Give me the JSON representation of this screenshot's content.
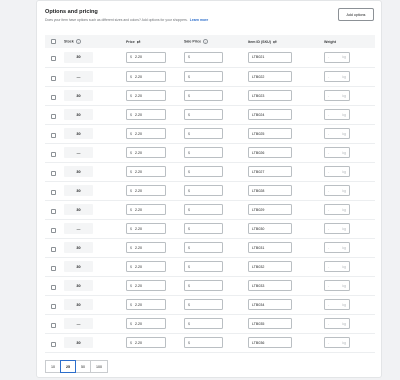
{
  "section": {
    "title": "Options and pricing",
    "description": "Does your item have options such as different sizes and colors? Add options for your shoppers.",
    "learn_more": "Learn more",
    "add_options_label": "Add options"
  },
  "table": {
    "columns": {
      "stock": "Stock",
      "price": "Price",
      "sale_price": "Sale Price",
      "item_id": "Item ID (SKU)",
      "weight": "Weight"
    },
    "currency_symbol": "$",
    "weight_placeholder": "-",
    "weight_unit": "kg",
    "rows": [
      {
        "stock": "30",
        "price": "2.20",
        "sale_price": "",
        "sku": "LTB021"
      },
      {
        "stock": "—",
        "price": "2.20",
        "sale_price": "",
        "sku": "LTB022"
      },
      {
        "stock": "30",
        "price": "2.20",
        "sale_price": "",
        "sku": "LTB023"
      },
      {
        "stock": "30",
        "price": "2.20",
        "sale_price": "",
        "sku": "LTB024"
      },
      {
        "stock": "30",
        "price": "2.20",
        "sale_price": "",
        "sku": "LTB025"
      },
      {
        "stock": "—",
        "price": "2.20",
        "sale_price": "",
        "sku": "LTB026"
      },
      {
        "stock": "30",
        "price": "2.20",
        "sale_price": "",
        "sku": "LTB027"
      },
      {
        "stock": "30",
        "price": "2.20",
        "sale_price": "",
        "sku": "LTB028"
      },
      {
        "stock": "30",
        "price": "2.20",
        "sale_price": "",
        "sku": "LTB029"
      },
      {
        "stock": "—",
        "price": "2.20",
        "sale_price": "",
        "sku": "LTB030"
      },
      {
        "stock": "30",
        "price": "2.20",
        "sale_price": "",
        "sku": "LTB031"
      },
      {
        "stock": "30",
        "price": "2.20",
        "sale_price": "",
        "sku": "LTB032"
      },
      {
        "stock": "30",
        "price": "2.20",
        "sale_price": "",
        "sku": "LTB033"
      },
      {
        "stock": "30",
        "price": "2.20",
        "sale_price": "",
        "sku": "LTB034"
      },
      {
        "stock": "—",
        "price": "2.20",
        "sale_price": "",
        "sku": "LTB035"
      },
      {
        "stock": "30",
        "price": "2.20",
        "sale_price": "",
        "sku": "LTB036"
      }
    ]
  },
  "pagination": {
    "options": [
      "10",
      "25",
      "50",
      "100"
    ],
    "selected": "25"
  },
  "colors": {
    "accent": "#2c6ecb",
    "header_bg": "#f4f5f6",
    "border": "#babfc3"
  },
  "icons": {
    "info": "info-circle-icon",
    "sort": "sort-arrows-icon"
  }
}
